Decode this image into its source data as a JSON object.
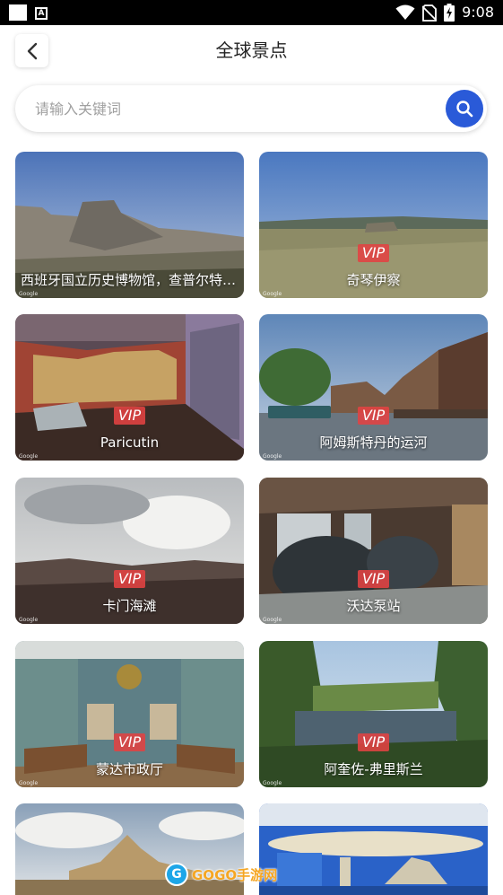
{
  "status_bar": {
    "time": "9:08",
    "icons": [
      "notification-square-icon",
      "a-badge-icon",
      "wifi-icon",
      "no-sim-icon",
      "battery-charging-icon"
    ]
  },
  "header": {
    "title": "全球景点",
    "back_icon": "chevron-left-icon"
  },
  "search": {
    "placeholder": "请输入关键词",
    "value": "",
    "button_icon": "search-icon",
    "accent_color": "#2a5ad8"
  },
  "vip_label": "VIP",
  "cards": [
    {
      "name": "西班牙国立历史博物馆，查普尔特佩克城堡",
      "vip": false
    },
    {
      "name": "奇琴伊察",
      "vip": true
    },
    {
      "name": "Paricutin",
      "vip": true
    },
    {
      "name": "阿姆斯特丹的运河",
      "vip": true
    },
    {
      "name": "卡门海滩",
      "vip": true
    },
    {
      "name": "沃达泵站",
      "vip": true
    },
    {
      "name": "蒙达市政厅",
      "vip": true
    },
    {
      "name": "阿奎佐-弗里斯兰",
      "vip": true
    },
    {
      "name": "",
      "vip": false
    },
    {
      "name": "",
      "vip": false
    }
  ],
  "watermark": {
    "text": "GOGO手游网"
  }
}
